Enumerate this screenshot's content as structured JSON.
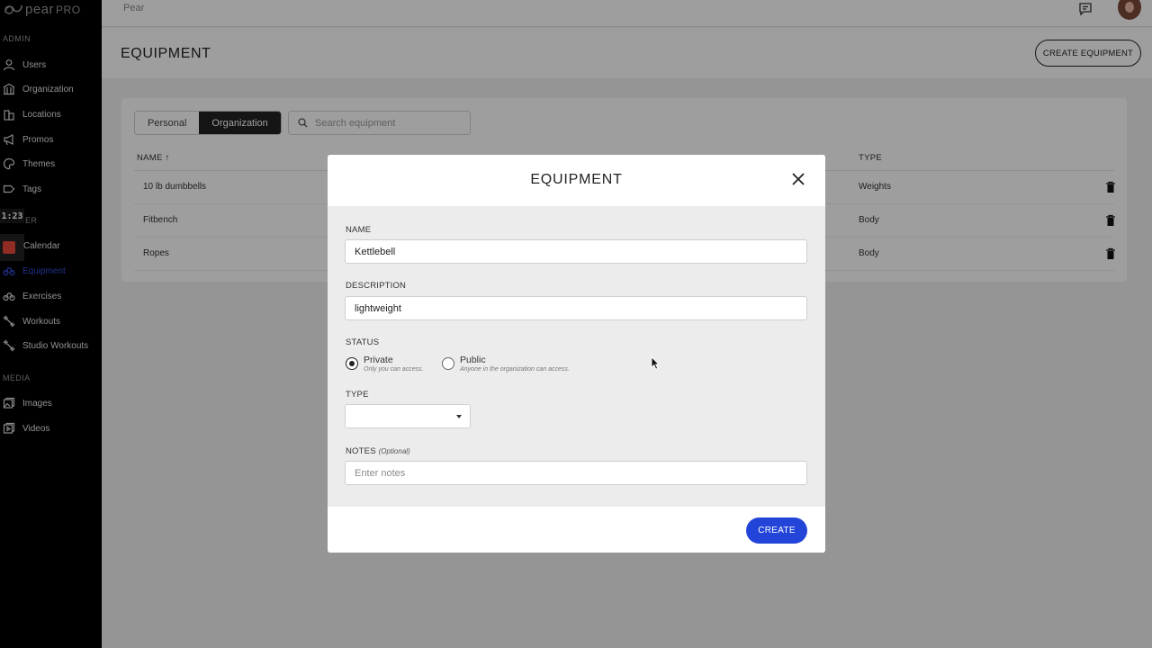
{
  "brand": {
    "name": "pear",
    "suffix": "PRO"
  },
  "sidebar": {
    "sections": [
      {
        "label": "ADMIN"
      },
      {
        "label": "ER"
      },
      {
        "label": "MEDIA"
      }
    ],
    "items": [
      {
        "label": "Users",
        "icon": "user-icon"
      },
      {
        "label": "Organization",
        "icon": "building-icon"
      },
      {
        "label": "Locations",
        "icon": "location-icon"
      },
      {
        "label": "Promos",
        "icon": "megaphone-icon"
      },
      {
        "label": "Themes",
        "icon": "palette-icon"
      },
      {
        "label": "Tags",
        "icon": "tag-icon"
      },
      {
        "label": "Calendar",
        "icon": "calendar-icon"
      },
      {
        "label": "Equipment",
        "icon": "equipment-icon",
        "active": true
      },
      {
        "label": "Exercises",
        "icon": "bike-icon"
      },
      {
        "label": "Workouts",
        "icon": "dumbbell-icon"
      },
      {
        "label": "Studio Workouts",
        "icon": "dumbbell-icon"
      },
      {
        "label": "Images",
        "icon": "image-icon"
      },
      {
        "label": "Videos",
        "icon": "video-icon"
      }
    ],
    "timer": "1:23",
    "active_color": "#3a4fe0",
    "record_color": "#e8483b"
  },
  "topbar": {
    "breadcrumb": "Pear"
  },
  "header": {
    "title": "EQUIPMENT",
    "create_label": "CREATE EQUIPMENT"
  },
  "list": {
    "tabs": [
      {
        "label": "Personal"
      },
      {
        "label": "Organization",
        "active": true
      }
    ],
    "search_placeholder": "Search equipment",
    "columns": {
      "name": "NAME ↑",
      "type": "TYPE"
    },
    "rows": [
      {
        "name": "10 lb dumbbells",
        "type": "Weights"
      },
      {
        "name": "Fitbench",
        "type": "Body"
      },
      {
        "name": "Ropes",
        "type": "Body"
      }
    ]
  },
  "modal": {
    "title": "EQUIPMENT",
    "name_label": "NAME",
    "name_value": "Kettlebell",
    "description_label": "DESCRIPTION",
    "description_value": "lightweight",
    "status_label": "STATUS",
    "status_options": [
      {
        "label": "Private",
        "hint": "Only you can access.",
        "selected": true
      },
      {
        "label": "Public",
        "hint": "Anyone in the organization can access.",
        "selected": false
      }
    ],
    "type_label": "TYPE",
    "type_value": "",
    "notes_label": "NOTES",
    "notes_optional": "(Optional)",
    "notes_placeholder": "Enter notes",
    "create_label": "CREATE",
    "create_color": "#2244d8"
  }
}
